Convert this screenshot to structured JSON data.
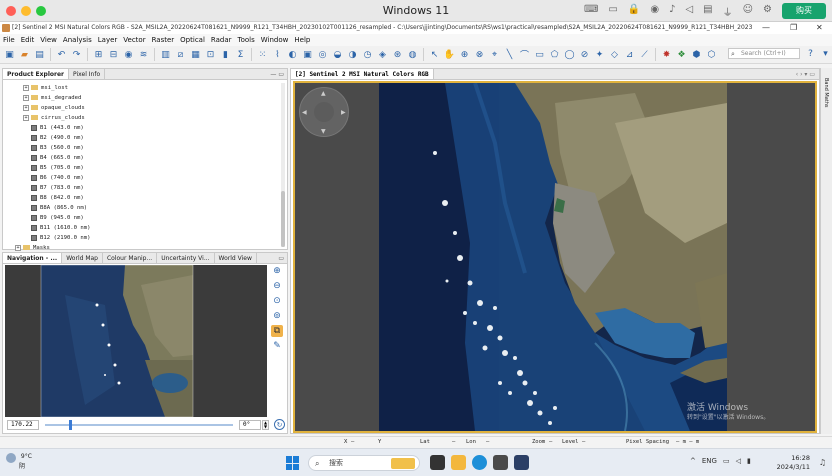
{
  "vm": {
    "title": "Windows 11",
    "buy_label": "购买"
  },
  "window": {
    "title": "[2] Sentinel 2 MSI Natural Colors RGB - S2A_MSIL2A_20220624T081621_N9999_R121_T34HBH_20230102T001126_resampled - C:\\Users\\jjinting\\Documents\\RS\\ws1\\practical\\resampled\\S2A_MSIL2A_20220624T081621_N9999_R121_T34HBH_20230102T00..."
  },
  "menu": [
    "File",
    "Edit",
    "View",
    "Analysis",
    "Layer",
    "Vector",
    "Raster",
    "Optical",
    "Radar",
    "Tools",
    "Window",
    "Help"
  ],
  "search": {
    "placeholder": "Search (Ctrl+I)"
  },
  "product_explorer": {
    "tabs": [
      "Product Explorer",
      "Pixel Info"
    ],
    "items": [
      {
        "label": "msi_lost",
        "kind": "folder"
      },
      {
        "label": "msi_degraded",
        "kind": "folder"
      },
      {
        "label": "opaque_clouds",
        "kind": "folder"
      },
      {
        "label": "cirrus_clouds",
        "kind": "folder"
      },
      {
        "label": "B1 (443.0 nm)",
        "kind": "band"
      },
      {
        "label": "B2 (490.0 nm)",
        "kind": "band"
      },
      {
        "label": "B3 (560.0 nm)",
        "kind": "band"
      },
      {
        "label": "B4 (665.0 nm)",
        "kind": "band"
      },
      {
        "label": "B5 (705.0 nm)",
        "kind": "band"
      },
      {
        "label": "B6 (740.0 nm)",
        "kind": "band"
      },
      {
        "label": "B7 (783.0 nm)",
        "kind": "band"
      },
      {
        "label": "B8 (842.0 nm)",
        "kind": "band"
      },
      {
        "label": "B8A (865.0 nm)",
        "kind": "band"
      },
      {
        "label": "B9 (945.0 nm)",
        "kind": "band"
      },
      {
        "label": "B11 (1610.0 nm)",
        "kind": "band"
      },
      {
        "label": "B12 (2190.0 nm)",
        "kind": "band"
      },
      {
        "label": "Masks",
        "kind": "folder"
      }
    ]
  },
  "navigation": {
    "tabs": [
      "Navigation - ...",
      "World Map",
      "Colour Manip...",
      "Uncertainty Vi...",
      "World View"
    ],
    "zoom_value": "170.22",
    "rotation_value": "0°"
  },
  "image_view": {
    "tab": "[2] Sentinel 2 MSI Natural Colors RGB"
  },
  "right_strip": {
    "label": "Band Maths"
  },
  "status": {
    "x": "X",
    "y": "Y",
    "lat": "Lat",
    "lon": "Lon",
    "zoom": "Zoom",
    "level": "Level",
    "pixel_spacing": "Pixel Spacing"
  },
  "watermark": {
    "line1": "激活 Windows",
    "line2": "转到\"设置\"以激活 Windows。"
  },
  "taskbar": {
    "weather_temp": "9°C",
    "weather_desc": "阴",
    "search_label": "搜索",
    "lang": "ENG",
    "time": "16:28",
    "date": "2024/3/11"
  },
  "colors": {
    "accent": "#1b7cd6",
    "buy": "#17a36d",
    "view_border": "#e0b23d"
  }
}
